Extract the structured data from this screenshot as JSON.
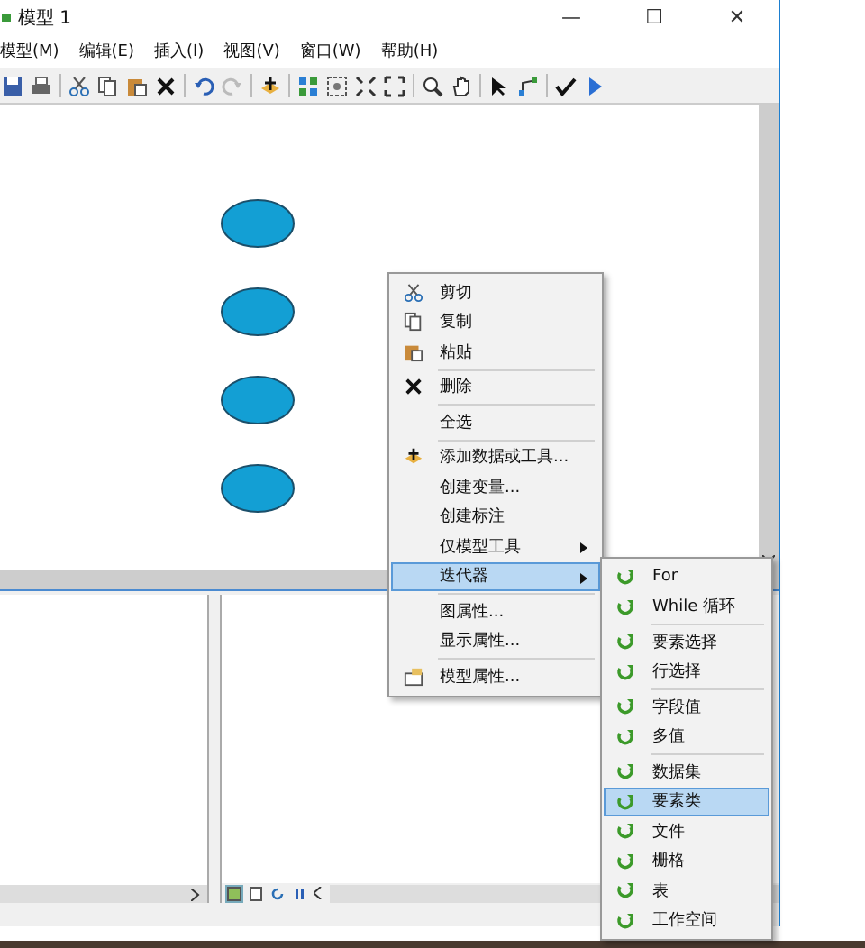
{
  "window": {
    "title": "模型 1",
    "controls": [
      "—",
      "☐",
      "✕"
    ]
  },
  "menu_bar": [
    "模型(M)",
    "编辑(E)",
    "插入(I)",
    "视图(V)",
    "窗口(W)",
    "帮助(H)"
  ],
  "context_menu": {
    "items": [
      {
        "label": "剪切",
        "separator_before": false,
        "submenu": false,
        "selected": false
      },
      {
        "label": "复制",
        "separator_before": false,
        "submenu": false,
        "selected": false
      },
      {
        "label": "粘贴",
        "separator_before": false,
        "submenu": false,
        "selected": false
      },
      {
        "label": "删除",
        "separator_before": true,
        "submenu": false,
        "selected": false
      },
      {
        "label": "全选",
        "separator_before": true,
        "submenu": false,
        "selected": false
      },
      {
        "label": "添加数据或工具...",
        "separator_before": true,
        "submenu": false,
        "selected": false
      },
      {
        "label": "创建变量...",
        "separator_before": false,
        "submenu": false,
        "selected": false
      },
      {
        "label": "创建标注",
        "separator_before": false,
        "submenu": false,
        "selected": false
      },
      {
        "label": "仅模型工具",
        "separator_before": false,
        "submenu": true,
        "selected": false
      },
      {
        "label": "迭代器",
        "separator_before": false,
        "submenu": true,
        "selected": true
      },
      {
        "label": "图属性...",
        "separator_before": true,
        "submenu": false,
        "selected": false
      },
      {
        "label": "显示属性...",
        "separator_before": false,
        "submenu": false,
        "selected": false
      },
      {
        "label": "模型属性...",
        "separator_before": true,
        "submenu": false,
        "selected": false
      }
    ]
  },
  "iterator_submenu": {
    "items": [
      {
        "label": "For",
        "separator_before": false,
        "selected": false
      },
      {
        "label": "While 循环",
        "separator_before": false,
        "selected": false
      },
      {
        "label": "要素选择",
        "separator_before": true,
        "selected": false
      },
      {
        "label": "行选择",
        "separator_before": false,
        "selected": false
      },
      {
        "label": "字段值",
        "separator_before": true,
        "selected": false
      },
      {
        "label": "多值",
        "separator_before": false,
        "selected": false
      },
      {
        "label": "数据集",
        "separator_before": true,
        "selected": false
      },
      {
        "label": "要素类",
        "separator_before": false,
        "selected": true
      },
      {
        "label": "文件",
        "separator_before": false,
        "selected": false
      },
      {
        "label": "栅格",
        "separator_before": false,
        "selected": false
      },
      {
        "label": "表",
        "separator_before": false,
        "selected": false
      },
      {
        "label": "工作空间",
        "separator_before": false,
        "selected": false
      }
    ]
  }
}
